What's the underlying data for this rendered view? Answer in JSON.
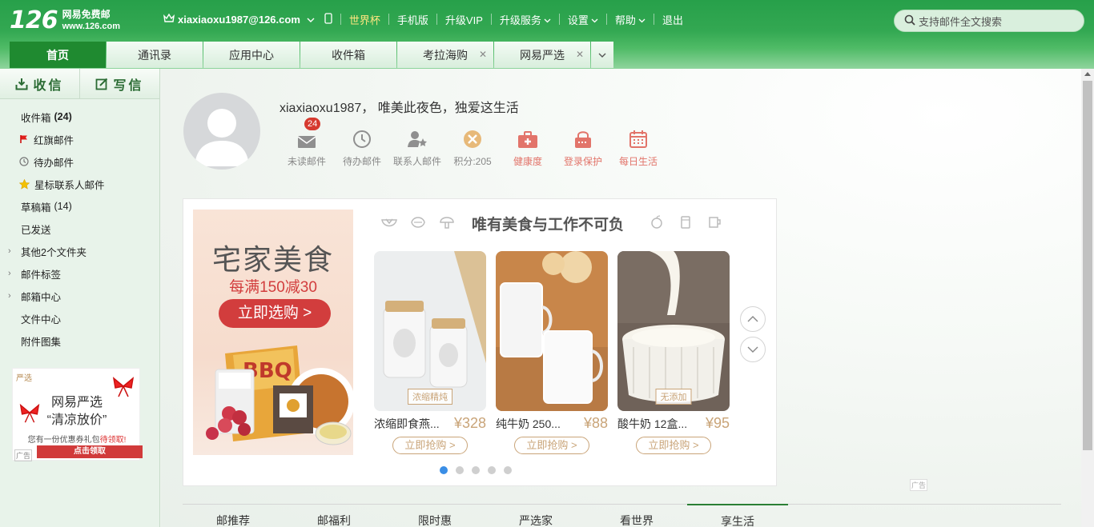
{
  "logo": {
    "num": "126",
    "cn": "网易免费邮",
    "url": "www.126.com"
  },
  "header": {
    "account": "xiaxiaoxu1987@126.com",
    "links": [
      "世界杯",
      "手机版",
      "升级VIP",
      "升级服务",
      "设置",
      "帮助",
      "退出"
    ],
    "search_placeholder": "支持邮件全文搜索"
  },
  "tabs": [
    {
      "label": "首页",
      "active": true
    },
    {
      "label": "通讯录"
    },
    {
      "label": "应用中心"
    },
    {
      "label": "收件箱"
    },
    {
      "label": "考拉海购",
      "closable": true
    },
    {
      "label": "网易严选",
      "closable": true
    }
  ],
  "sidebar": {
    "receive": "收信",
    "compose": "写信",
    "folders": [
      {
        "label": "收件箱",
        "count": "(24)"
      },
      {
        "label": "红旗邮件",
        "icon": "red-flag-icon"
      },
      {
        "label": "待办邮件",
        "icon": "clock-icon"
      },
      {
        "label": "星标联系人邮件",
        "icon": "star-icon"
      },
      {
        "label": "草稿箱",
        "count": "(14)"
      },
      {
        "label": "已发送"
      },
      {
        "label": "其他2个文件夹",
        "caret": true
      },
      {
        "label": "邮件标签",
        "caret": true
      },
      {
        "label": "邮箱中心",
        "caret": true
      },
      {
        "label": "文件中心"
      },
      {
        "label": "附件图集"
      }
    ],
    "ad": {
      "brand": "严选",
      "line1": "网易严选",
      "line2": "“清凉放价”",
      "line3a": "您有一份优惠券礼包",
      "line3b": "待领取!",
      "button": "点击领取",
      "tag": "广告"
    }
  },
  "welcome": {
    "greeting": "xiaxiaoxu1987， 唯美此夜色，独爱这生活",
    "unread_badge": "24",
    "quick": [
      {
        "label": "未读邮件",
        "icon": "envelope-icon"
      },
      {
        "label": "待办邮件",
        "icon": "clock-icon"
      },
      {
        "label": "联系人邮件",
        "icon": "contact-star-icon"
      },
      {
        "label": "积分:205",
        "icon": "points-coin-icon"
      },
      {
        "label": "健康度",
        "icon": "health-kit-icon"
      },
      {
        "label": "登录保护",
        "icon": "login-protect-icon"
      },
      {
        "label": "每日生活",
        "icon": "calendar-icon"
      }
    ]
  },
  "promo": {
    "big_ad": {
      "headline": "宅家美食",
      "sub": "每满150减30",
      "button": "立即选购 >"
    },
    "title": "唯有美食与工作不可负",
    "products": [
      {
        "name": "浓缩即食燕...",
        "price": "¥328",
        "tag": "浓缩精炖",
        "button": "立即抢购 >"
      },
      {
        "name": "纯牛奶 250...",
        "price": "¥88",
        "tag": "",
        "button": "立即抢购 >"
      },
      {
        "name": "酸牛奶 12盒...",
        "price": "¥95",
        "tag": "无添加",
        "button": "立即抢购 >"
      }
    ],
    "dots": 5,
    "active_dot": 0,
    "ad_tag": "广告"
  },
  "bottom_tabs": [
    {
      "label": "邮推荐"
    },
    {
      "label": "邮福利"
    },
    {
      "label": "限时惠"
    },
    {
      "label": "严选家"
    },
    {
      "label": "看世界"
    },
    {
      "label": "享生活",
      "active": true
    }
  ],
  "colors": {
    "brand_green": "#1f8a30",
    "badge_red": "#d63a2f",
    "gold": "#c9a478",
    "dot_active": "#3a8ee6"
  }
}
